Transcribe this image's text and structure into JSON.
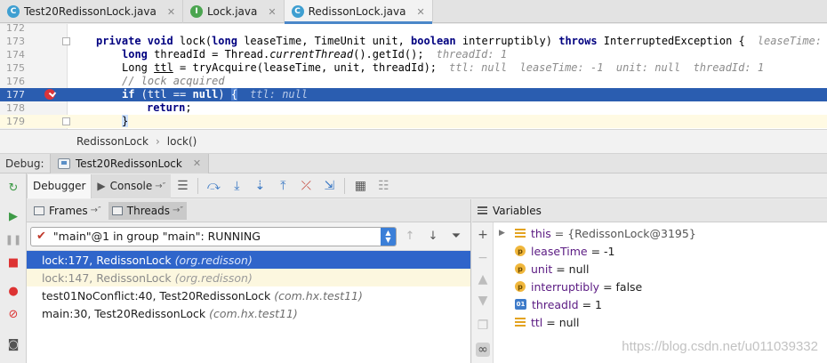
{
  "tabs": [
    {
      "label": "Test20RedissonLock.java",
      "icon": "class-icon",
      "active": false
    },
    {
      "label": "Lock.java",
      "icon": "interface-icon",
      "active": false
    },
    {
      "label": "RedissonLock.java",
      "icon": "class-icon",
      "active": true
    }
  ],
  "editor": {
    "lines": [
      {
        "num": "172"
      },
      {
        "num": "173",
        "kw1": "private void",
        "t1": " lock(",
        "kw2": "long",
        "t2": " leaseTime, TimeUnit unit, ",
        "kw3": "boolean",
        "t3": " interruptibly) ",
        "kw4": "throws",
        "t4": " InterruptedException {",
        "hint": "leaseTime: -1"
      },
      {
        "num": "174",
        "kw1": "long",
        "t1": " threadId = Thread.",
        "it": "currentThread",
        "t2": "().getId();",
        "hint": "threadId: 1"
      },
      {
        "num": "175",
        "t1": "Long ",
        "u": "ttl",
        "t2": " = tryAcquire(leaseTime, unit, threadId);",
        "hint": "ttl: null  leaseTime: -1  unit: null  threadId: 1"
      },
      {
        "num": "176",
        "comment": "// lock acquired"
      },
      {
        "num": "177",
        "kw1": "if",
        "t1": " (ttl == ",
        "kw2": "null",
        "t2": ") ",
        "brace": "{",
        "hint": "ttl: null"
      },
      {
        "num": "178",
        "kw1": "return",
        "t1": ";"
      },
      {
        "num": "179",
        "brace": "}"
      }
    ]
  },
  "breadcrumb": {
    "items": [
      "RedissonLock",
      "lock()"
    ]
  },
  "debug": {
    "label": "Debug:",
    "session": "Test20RedissonLock"
  },
  "debugger_toolbar": {
    "debugger_tab": "Debugger",
    "console_tab": "Console",
    "pin": "→″"
  },
  "frames_panel": {
    "frames_tab": "Frames",
    "threads_tab": "Threads",
    "pin": "→″",
    "thread_selector": "\"main\"@1 in group \"main\": RUNNING",
    "frames": [
      {
        "method": "lock:177, RedissonLock",
        "pkg": "(org.redisson)",
        "state": "selected"
      },
      {
        "method": "lock:147, RedissonLock",
        "pkg": "(org.redisson)",
        "state": "library"
      },
      {
        "method": "test01NoConflict:40, Test20RedissonLock",
        "pkg": "(com.hx.test11)",
        "state": "normal"
      },
      {
        "method": "main:30, Test20RedissonLock",
        "pkg": "(com.hx.test11)",
        "state": "normal"
      }
    ]
  },
  "variables_panel": {
    "title": "Variables",
    "vars": [
      {
        "icon": "field-icon",
        "name": "this",
        "value": "{RedissonLock@3195}",
        "expandable": true
      },
      {
        "icon": "param-icon",
        "name": "leaseTime",
        "value": "-1"
      },
      {
        "icon": "param-icon",
        "name": "unit",
        "value": "null"
      },
      {
        "icon": "param-icon",
        "name": "interruptibly",
        "value": "false"
      },
      {
        "icon": "local-var-icon",
        "name": "threadId",
        "value": "1"
      },
      {
        "icon": "field-icon",
        "name": "ttl",
        "value": "null"
      }
    ]
  },
  "watermark": "https://blog.csdn.net/u011039332",
  "colors": {
    "execution_line": "#2a5db0",
    "selected_frame": "#2f65ca",
    "keyword": "#000080",
    "breakpoint": "#d9343a"
  }
}
